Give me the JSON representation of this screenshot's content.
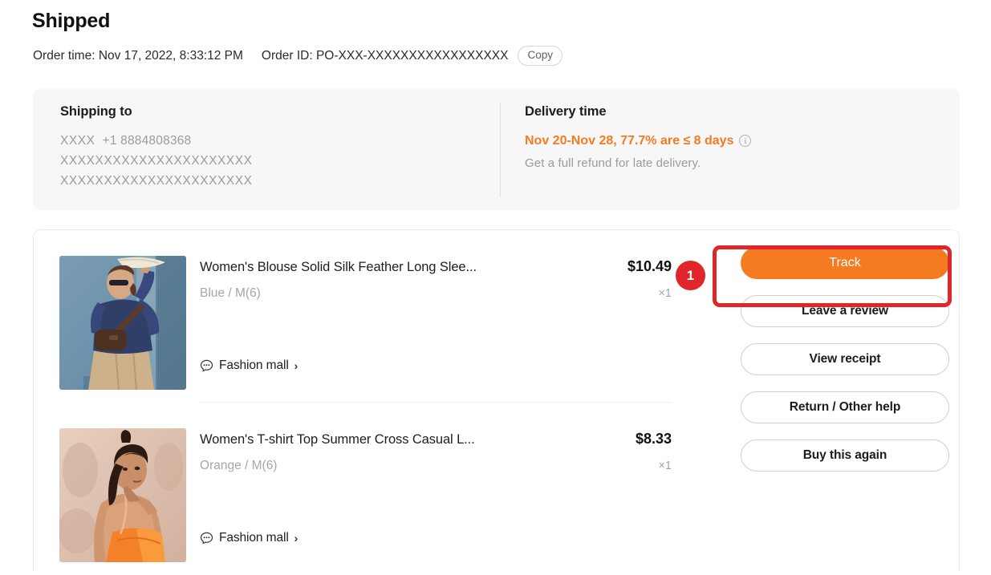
{
  "header": {
    "status_title": "Shipped",
    "order_time_label": "Order time:",
    "order_time_value": "Nov 17, 2022, 8:33:12 PM",
    "order_id_label": "Order ID:",
    "order_id_value": "PO-XXX-XXXXXXXXXXXXXXXXX",
    "copy_label": "Copy"
  },
  "shipping": {
    "heading": "Shipping to",
    "recipient_name": "XXXX",
    "phone": "+1 8884808368",
    "address_line1": "XXXXXXXXXXXXXXXXXXXXXX",
    "address_line2": "XXXXXXXXXXXXXXXXXXXXXX"
  },
  "delivery": {
    "heading": "Delivery time",
    "window": "Nov 20-Nov 28, 77.7% are ≤ 8 days",
    "info_icon_glyph": "i",
    "refund_note": "Get a full refund for late delivery.",
    "accent_color": "#f47b20"
  },
  "items": [
    {
      "title": "Women's Blouse Solid Silk Feather Long Slee...",
      "price": "$10.49",
      "variant": "Blue / M(6)",
      "quantity": "×1",
      "store": "Fashion mall",
      "store_chevron": "›"
    },
    {
      "title": "Women's T-shirt Top Summer Cross Casual L...",
      "price": "$8.33",
      "variant": "Orange / M(6)",
      "quantity": "×1",
      "store": "Fashion mall",
      "store_chevron": "›"
    }
  ],
  "actions": {
    "track": "Track",
    "leave_review": "Leave a review",
    "view_receipt": "View receipt",
    "return_help": "Return / Other help",
    "buy_again": "Buy this again"
  },
  "annotation": {
    "step_number": "1",
    "highlight_color": "#e0262a"
  }
}
